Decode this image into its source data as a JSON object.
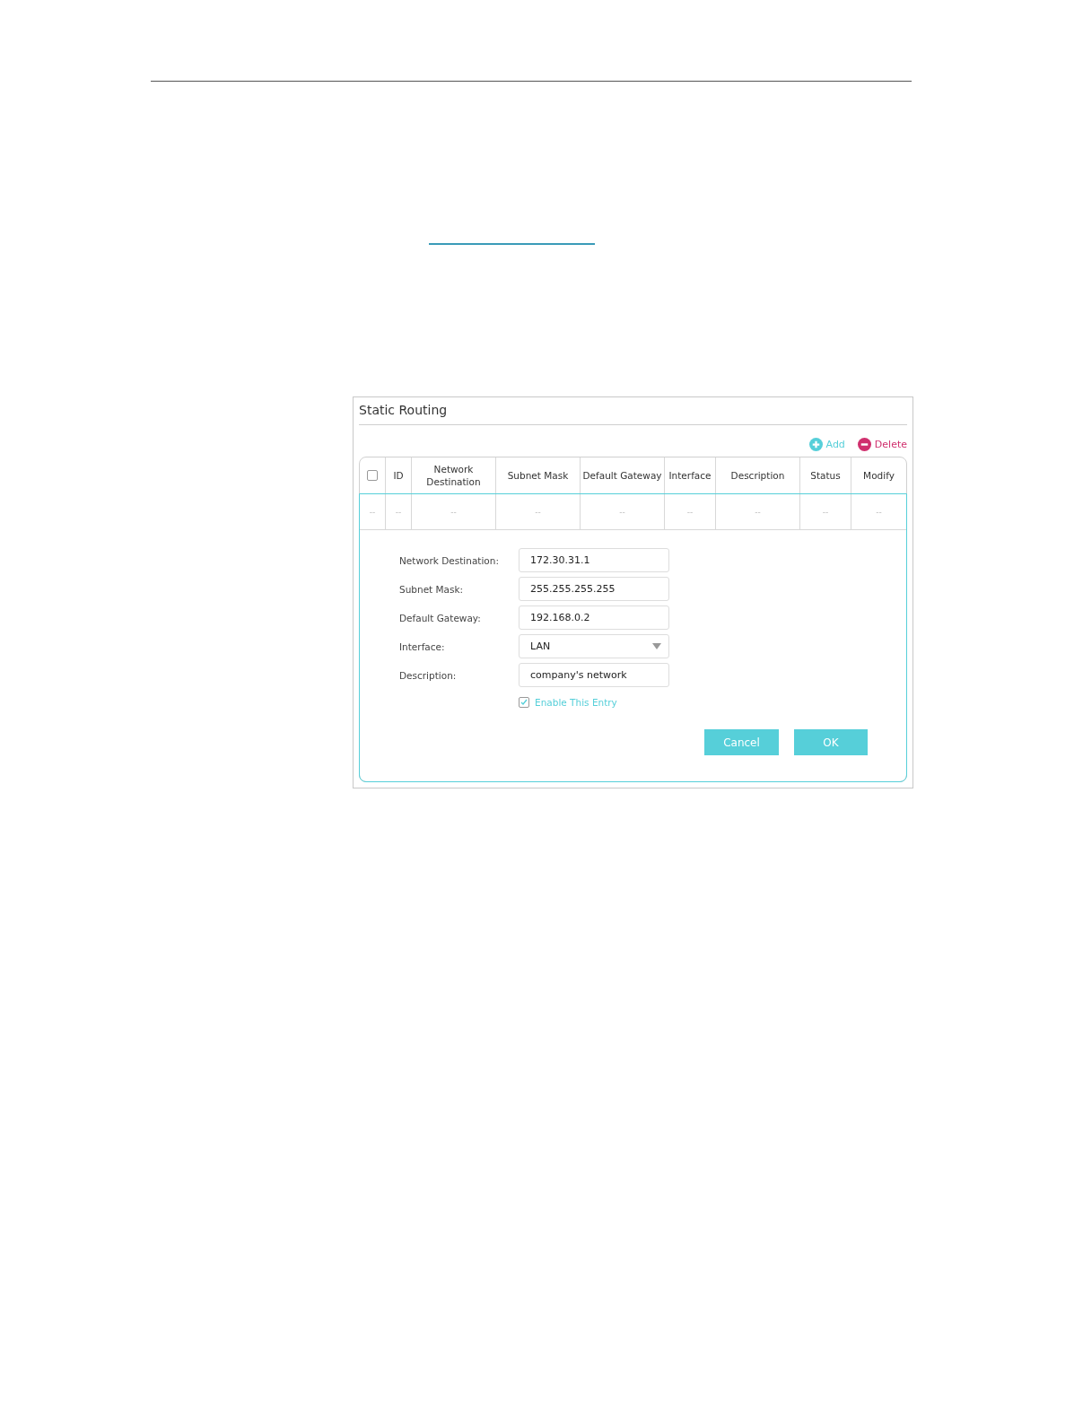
{
  "panel": {
    "title": "Static Routing"
  },
  "actions": [
    {
      "kind": "add",
      "label": "Add"
    },
    {
      "kind": "delete",
      "label": "Delete"
    }
  ],
  "table": {
    "columns": [
      {
        "kind": "checkbox",
        "checked": false
      },
      {
        "kind": "text",
        "label": "ID"
      },
      {
        "kind": "text",
        "label": "Network Destination"
      },
      {
        "kind": "text",
        "label": "Subnet Mask"
      },
      {
        "kind": "text",
        "label": "Default Gateway"
      },
      {
        "kind": "text",
        "label": "Interface"
      },
      {
        "kind": "text",
        "label": "Description"
      },
      {
        "kind": "text",
        "label": "Status"
      },
      {
        "kind": "text",
        "label": "Modify"
      }
    ],
    "rows": [
      {
        "cells": [
          "--",
          "--",
          "--",
          "--",
          "--",
          "--",
          "--",
          "--",
          "--"
        ]
      }
    ]
  },
  "form": {
    "fields": [
      {
        "kind": "text",
        "label": "Network Destination:",
        "value": "172.30.31.1"
      },
      {
        "kind": "text",
        "label": "Subnet Mask:",
        "value": "255.255.255.255"
      },
      {
        "kind": "text",
        "label": "Default Gateway:",
        "value": "192.168.0.2"
      },
      {
        "kind": "select",
        "label": "Interface:",
        "value": "LAN"
      },
      {
        "kind": "text",
        "label": "Description:",
        "value": "company's network"
      }
    ],
    "enable": {
      "label": "Enable This Entry",
      "checked": true
    },
    "buttons": [
      "Cancel",
      "OK"
    ]
  }
}
